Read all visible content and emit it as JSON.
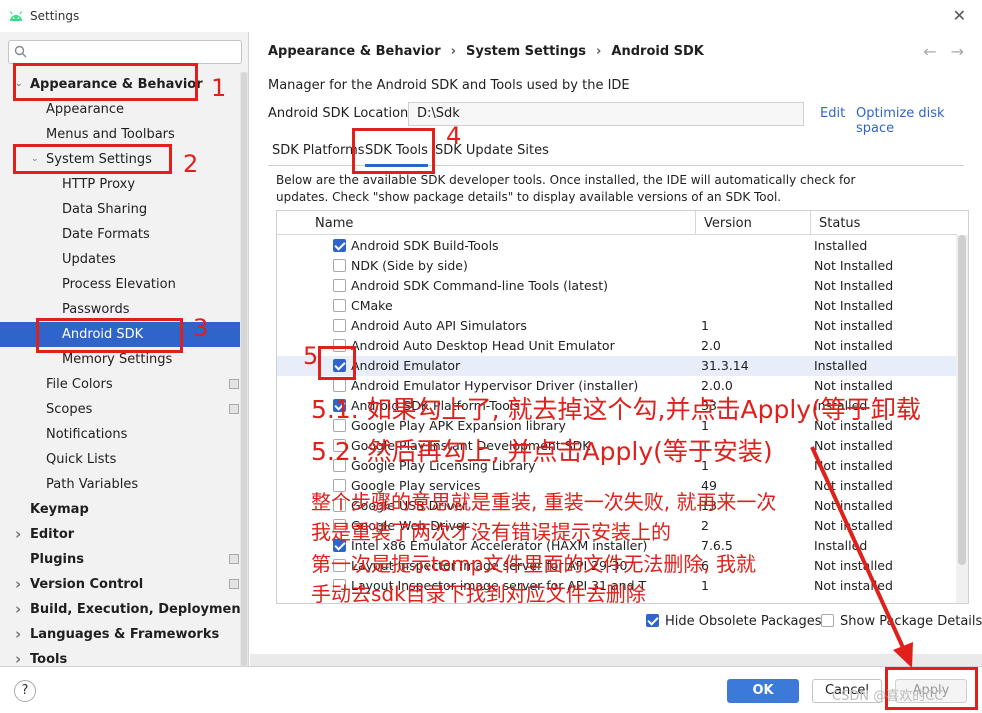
{
  "window": {
    "title": "Settings"
  },
  "sidebar": {
    "search_placeholder": "",
    "items": [
      {
        "label": "Appearance & Behavior",
        "bold": true,
        "expanded": true,
        "indent": 0
      },
      {
        "label": "Appearance",
        "indent": 1
      },
      {
        "label": "Menus and Toolbars",
        "indent": 1
      },
      {
        "label": "System Settings",
        "expanded": true,
        "indent": 1
      },
      {
        "label": "HTTP Proxy",
        "indent": 2
      },
      {
        "label": "Data Sharing",
        "indent": 2
      },
      {
        "label": "Date Formats",
        "indent": 2
      },
      {
        "label": "Updates",
        "indent": 2
      },
      {
        "label": "Process Elevation",
        "indent": 2
      },
      {
        "label": "Passwords",
        "indent": 2
      },
      {
        "label": "Android SDK",
        "indent": 2,
        "selected": true
      },
      {
        "label": "Memory Settings",
        "indent": 2
      },
      {
        "label": "File Colors",
        "indent": 1,
        "project": true
      },
      {
        "label": "Scopes",
        "indent": 1,
        "project": true
      },
      {
        "label": "Notifications",
        "indent": 1
      },
      {
        "label": "Quick Lists",
        "indent": 1
      },
      {
        "label": "Path Variables",
        "indent": 1
      },
      {
        "label": "Keymap",
        "bold": true,
        "indent": 0
      },
      {
        "label": "Editor",
        "bold": true,
        "indent": 0,
        "collapsed": true
      },
      {
        "label": "Plugins",
        "bold": true,
        "indent": 0,
        "project": true
      },
      {
        "label": "Version Control",
        "bold": true,
        "indent": 0,
        "collapsed": true,
        "project": true
      },
      {
        "label": "Build, Execution, Deployment",
        "bold": true,
        "indent": 0,
        "collapsed": true
      },
      {
        "label": "Languages & Frameworks",
        "bold": true,
        "indent": 0,
        "collapsed": true
      },
      {
        "label": "Tools",
        "bold": true,
        "indent": 0,
        "collapsed": true
      }
    ]
  },
  "breadcrumb": {
    "items": [
      "Appearance & Behavior",
      "System Settings",
      "Android SDK"
    ],
    "separator": "›"
  },
  "nav": {
    "back": "←",
    "forward": "→"
  },
  "main": {
    "description": "Manager for the Android SDK and Tools used by the IDE",
    "location_label": "Android SDK Location:",
    "location_value": "D:\\Sdk",
    "edit_link": "Edit",
    "optimize_link": "Optimize disk space",
    "tabs": [
      "SDK Platforms",
      "SDK Tools",
      "SDK Update Sites"
    ],
    "active_tab": "SDK Tools",
    "tools_desc_1": "Below are the available SDK developer tools. Once installed, the IDE will automatically check for",
    "tools_desc_2": "updates. Check \"show package details\" to display available versions of an SDK Tool.",
    "columns": [
      "Name",
      "Version",
      "Status"
    ],
    "rows": [
      {
        "name": "Android SDK Build-Tools",
        "version": "",
        "status": "Installed",
        "checked": true
      },
      {
        "name": "NDK (Side by side)",
        "version": "",
        "status": "Not Installed",
        "checked": false
      },
      {
        "name": "Android SDK Command-line Tools (latest)",
        "version": "",
        "status": "Not Installed",
        "checked": false
      },
      {
        "name": "CMake",
        "version": "",
        "status": "Not Installed",
        "checked": false
      },
      {
        "name": "Android Auto API Simulators",
        "version": "1",
        "status": "Not installed",
        "checked": false
      },
      {
        "name": "Android Auto Desktop Head Unit Emulator",
        "version": "2.0",
        "status": "Not installed",
        "checked": false
      },
      {
        "name": "Android Emulator",
        "version": "31.3.14",
        "status": "Installed",
        "checked": true,
        "selected": true
      },
      {
        "name": "Android Emulator Hypervisor Driver (installer)",
        "version": "2.0.0",
        "status": "Not installed",
        "checked": false
      },
      {
        "name": "Android SDK Platform-Tools",
        "version": "33",
        "status": "Installed",
        "checked": true
      },
      {
        "name": "Google Play APK Expansion library",
        "version": "1",
        "status": "Not installed",
        "checked": false
      },
      {
        "name": "Google Play Instant Development SDK",
        "version": "1",
        "status": "Not installed",
        "checked": false
      },
      {
        "name": "Google Play Licensing Library",
        "version": "1",
        "status": "Not installed",
        "checked": false
      },
      {
        "name": "Google Play services",
        "version": "49",
        "status": "Not installed",
        "checked": false
      },
      {
        "name": "Google USB Driver",
        "version": "13",
        "status": "Not installed",
        "checked": false
      },
      {
        "name": "Google Web Driver",
        "version": "2",
        "status": "Not installed",
        "checked": false
      },
      {
        "name": "Intel x86 Emulator Accelerator (HAXM installer)",
        "version": "7.6.5",
        "status": "Installed",
        "checked": true
      },
      {
        "name": "Layout Inspector image server for API 29-30",
        "version": "6",
        "status": "Not installed",
        "checked": false
      },
      {
        "name": "Layout Inspector image server for API 31 and T",
        "version": "1",
        "status": "Not installed",
        "checked": false
      }
    ],
    "hide_obsolete_label": "Hide Obsolete Packages",
    "hide_obsolete_checked": true,
    "show_details_label": "Show Package Details",
    "show_details_checked": false
  },
  "footer": {
    "help": "?",
    "ok": "OK",
    "cancel": "Cancel",
    "apply": "Apply"
  },
  "annotations": {
    "n1": "1",
    "n2": "2",
    "n3": "3",
    "n4": "4",
    "n5": "5",
    "step51": "5.1. 如果勾上了, 就去掉这个勾,并点击Apply(等于卸载",
    "step52": "5.2. 然后再勾上, 并点击Apply(等于安装)",
    "line1": "整个步骤的意思就是重装, 重装一次失败, 就再来一次",
    "line2": "我是重装了两次才没有错误提示安装上的",
    "line3": "第一次是提示temp文件里面的文件无法删除, 我就",
    "line4": "手动去sdk目录下找到对应文件去删除",
    "watermark": "CSDN @喜欢的CC"
  },
  "colors": {
    "accent": "#2f65ca",
    "annotation": "#e0201b",
    "ok_button": "#3c7ad9"
  }
}
